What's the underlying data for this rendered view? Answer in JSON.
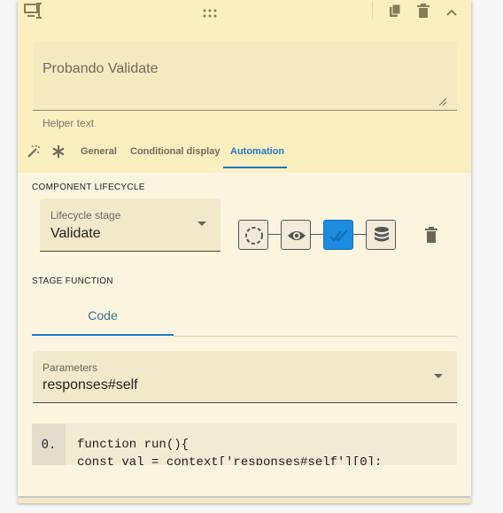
{
  "toolbar": {
    "icons": [
      "component-type-icon",
      "drag-handle-icon",
      "copy-icon",
      "delete-icon",
      "collapse-icon"
    ]
  },
  "label_field": {
    "value": "Probando Validate",
    "helper_text": "Helper text"
  },
  "tabs": {
    "items": [
      {
        "label": "General",
        "active": false
      },
      {
        "label": "Conditional display",
        "active": false
      },
      {
        "label": "Automation",
        "active": true
      }
    ]
  },
  "lifecycle": {
    "section_title": "COMPONENT LIFECYCLE",
    "select_label": "Lifecycle stage",
    "select_value": "Validate",
    "stages": [
      {
        "icon": "init-circle-icon",
        "active": false
      },
      {
        "icon": "eye-icon",
        "active": false
      },
      {
        "icon": "double-check-icon",
        "active": true
      },
      {
        "icon": "database-icon",
        "active": false
      }
    ]
  },
  "stage_function": {
    "section_title": "STAGE FUNCTION",
    "code_tab_label": "Code",
    "params_label": "Parameters",
    "params_value": "responses#self",
    "line_number": "0.",
    "code_lines": [
      "function run(){",
      "const val = context['responses#self'][0];"
    ]
  },
  "colors": {
    "accent": "#1e7ac9",
    "header_bg": "#fbeebf",
    "card_bg": "#fbf5df"
  }
}
